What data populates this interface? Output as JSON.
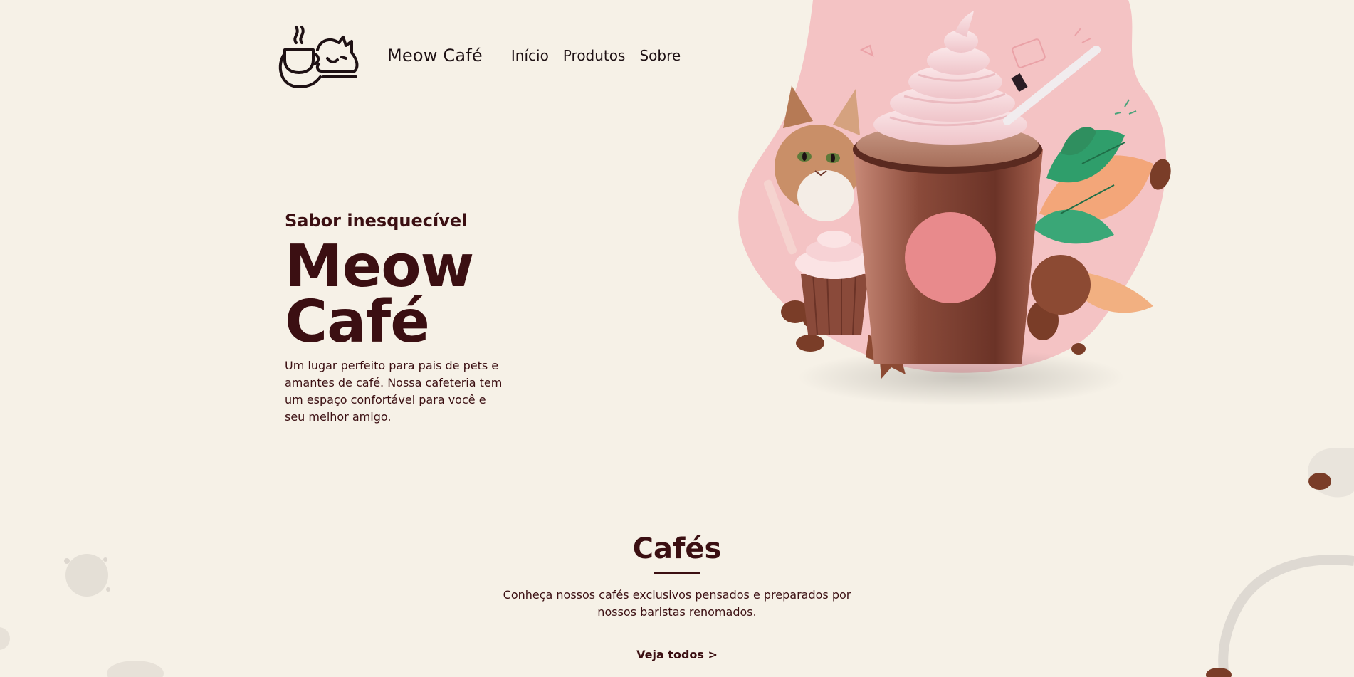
{
  "header": {
    "brand": "Meow Café",
    "nav": [
      "Início",
      "Produtos",
      "Sobre"
    ],
    "logo_icon": "cat-coffee-cup-logo"
  },
  "hero": {
    "eyebrow": "Sabor inesquecível",
    "title_line1": "Meow",
    "title_line2": "Café",
    "description": "Um lugar perfeito para pais de pets e amantes de café. Nossa cafeteria tem um espaço confortável para você e seu melhor amigo.",
    "image_icon": "frappe-cat-illustration"
  },
  "cafes": {
    "title": "Cafés",
    "description": "Conheça nossos cafés exclusivos pensados e preparados por nossos baristas renomados.",
    "link": "Veja todos >"
  },
  "colors": {
    "background": "#f6f1e7",
    "primary_text": "#3b0f12",
    "accent_pink": "#f4c3c4",
    "circle_pink": "#e88a8c",
    "cup_brown": "#8a4a3a"
  }
}
